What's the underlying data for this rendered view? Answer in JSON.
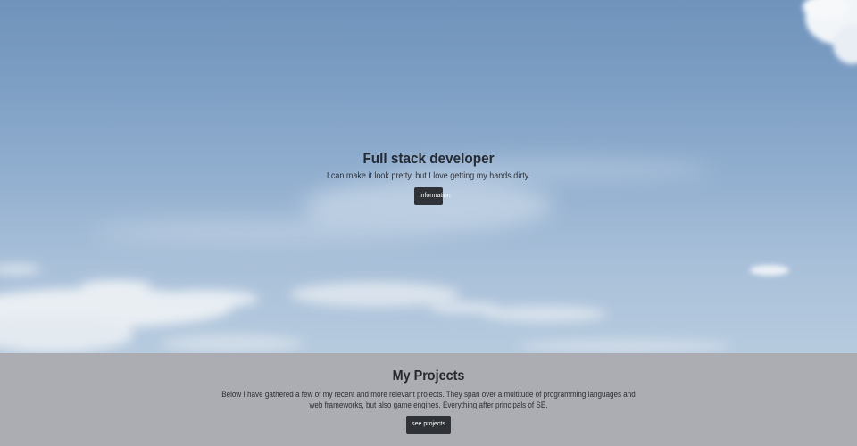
{
  "hero": {
    "title": "Full stack developer",
    "subtitle": "I can make it look pretty, but I love getting my hands dirty.",
    "button_label": "information",
    "background_top": "#6f93bb",
    "background_bottom": "#b7cbdf"
  },
  "projects": {
    "title": "My Projects",
    "description": "Below I have gathered a few of my recent and more relevant projects. They span over a multitude of programming languages and web frameworks, but also game engines. Everything after principals of SE.",
    "button_label": "see projects",
    "background": "#acadb3"
  }
}
